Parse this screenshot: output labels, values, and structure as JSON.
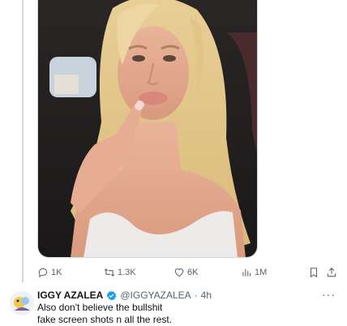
{
  "post": {
    "media_alt": "Selfie photo",
    "actions": {
      "replies": "1K",
      "reposts": "1.3K",
      "likes": "6K",
      "views": "1M"
    }
  },
  "reply_tweet": {
    "display_name": "IGGY AZALEA",
    "handle": "@IGGYAZALEA",
    "separator": "·",
    "time": "4h",
    "more_label": "···",
    "text_line1": "Also don't believe the bullshit",
    "text_line2": "fake screen shots n all the rest."
  },
  "colors": {
    "verified": "#1d9bf0",
    "secondary_text": "#536471",
    "thread_line": "#cfd9de"
  }
}
